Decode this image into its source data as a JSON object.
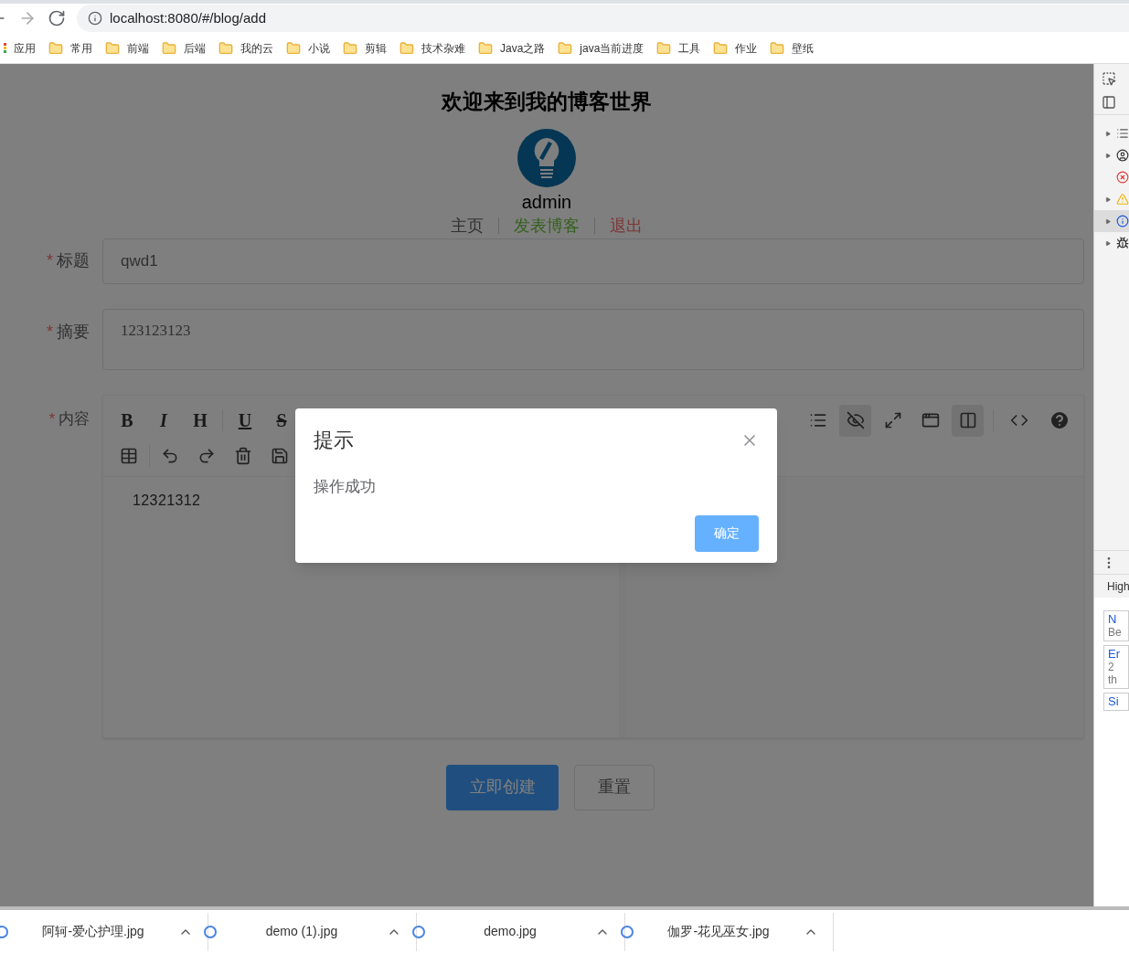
{
  "browser": {
    "url": "localhost:8080/#/blog/add",
    "bookmarks": [
      {
        "kind": "apps",
        "label": "应用"
      },
      {
        "kind": "folder",
        "label": "常用"
      },
      {
        "kind": "folder",
        "label": "前端"
      },
      {
        "kind": "folder",
        "label": "后端"
      },
      {
        "kind": "folder",
        "label": "我的云"
      },
      {
        "kind": "folder",
        "label": "小说"
      },
      {
        "kind": "folder",
        "label": "剪辑"
      },
      {
        "kind": "folder",
        "label": "技术杂难"
      },
      {
        "kind": "folder",
        "label": "Java之路"
      },
      {
        "kind": "folder",
        "label": "java当前进度"
      },
      {
        "kind": "folder",
        "label": "工具"
      },
      {
        "kind": "folder",
        "label": "作业"
      },
      {
        "kind": "folder",
        "label": "壁纸"
      }
    ]
  },
  "page": {
    "heading": "欢迎来到我的博客世界",
    "username": "admin",
    "nav": [
      {
        "label": "主页",
        "color": "#303133"
      },
      {
        "label": "发表博客",
        "color": "#34611d"
      },
      {
        "label": "退出",
        "color": "#7b3636"
      }
    ],
    "form": {
      "required_mark": "*",
      "title_label": "标题",
      "title_value": "qwd1",
      "summary_label": "摘要",
      "summary_value": "123123123",
      "content_label": "内容",
      "content_value": "12321312",
      "format_buttons": [
        "B",
        "I",
        "H",
        "U",
        "S"
      ],
      "view_buttons": [
        {
          "active": false
        },
        {
          "active": true
        },
        {
          "active": false
        },
        {
          "active": false
        },
        {
          "active": true
        }
      ],
      "submit": "立即创建",
      "reset": "重置"
    }
  },
  "dialog": {
    "title": "提示",
    "message": "操作成功",
    "confirm": "确定"
  },
  "devtools": {
    "rows": [
      {
        "selected": false
      },
      {
        "selected": false
      },
      {
        "selected": false
      },
      {
        "selected": false
      },
      {
        "selected": true
      },
      {
        "selected": false
      }
    ],
    "tab": "High",
    "messages": [
      {
        "title": "N",
        "lines": [
          "Be"
        ]
      },
      {
        "title": "Er",
        "lines": [
          "2",
          "th"
        ]
      },
      {
        "title": "Si"
      }
    ]
  },
  "downloads": [
    "阿轲-爱心护理.jpg",
    "demo (1).jpg",
    "demo.jpg",
    "伽罗-花见巫女.jpg"
  ]
}
